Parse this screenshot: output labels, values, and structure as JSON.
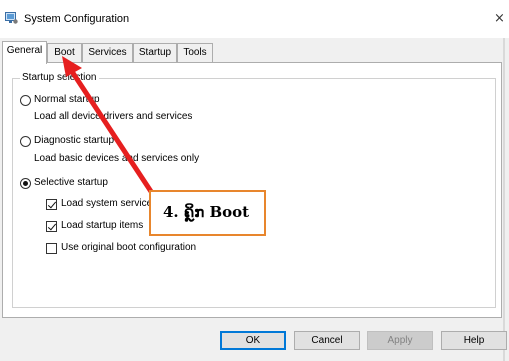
{
  "window": {
    "title": "System Configuration",
    "close_glyph": "×",
    "icon": "system-config-icon"
  },
  "tabs": [
    {
      "label": "General",
      "active": true
    },
    {
      "label": "Boot",
      "active": false
    },
    {
      "label": "Services",
      "active": false
    },
    {
      "label": "Startup",
      "active": false
    },
    {
      "label": "Tools",
      "active": false
    }
  ],
  "startup_selection": {
    "title": "Startup selection",
    "normal": {
      "label": "Normal startup",
      "description": "Load all device drivers and services",
      "selected": false
    },
    "diagnostic": {
      "label": "Diagnostic startup",
      "description": "Load basic devices and services only",
      "selected": false
    },
    "selective": {
      "label": "Selective startup",
      "selected": true
    },
    "options": [
      {
        "label": "Load system services",
        "checked": true
      },
      {
        "label": "Load startup items",
        "checked": true
      },
      {
        "label": "Use original boot configuration",
        "checked": false
      }
    ]
  },
  "buttons": {
    "ok": "OK",
    "cancel": "Cancel",
    "apply": "Apply",
    "help": "Help"
  },
  "annotation": {
    "text": "4. ຄຼິກ Boot",
    "border_color": "#e8862d",
    "arrow_color": "#e61f1f"
  }
}
